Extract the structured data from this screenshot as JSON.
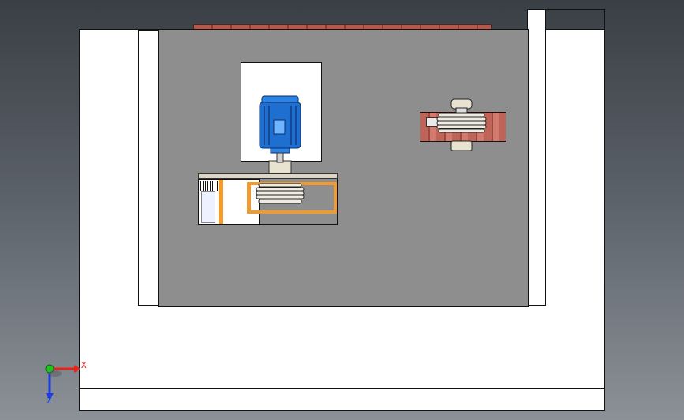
{
  "viewport": {
    "background_top": "#3a3f45",
    "background_bottom": "#8b9197"
  },
  "model": {
    "frame_color": "#ffffff",
    "panel_color": "#8e8e8e",
    "brick_color": "#b5574a",
    "motor_color": "#1f6fd1",
    "bracket_color": "#f29a2e",
    "pulley_color": "#e8e2d0"
  },
  "triad": {
    "x_label": "X",
    "z_label": "Z",
    "x_color": "#e8231c",
    "y_color": "#24c224",
    "z_color": "#1c3ce8"
  }
}
